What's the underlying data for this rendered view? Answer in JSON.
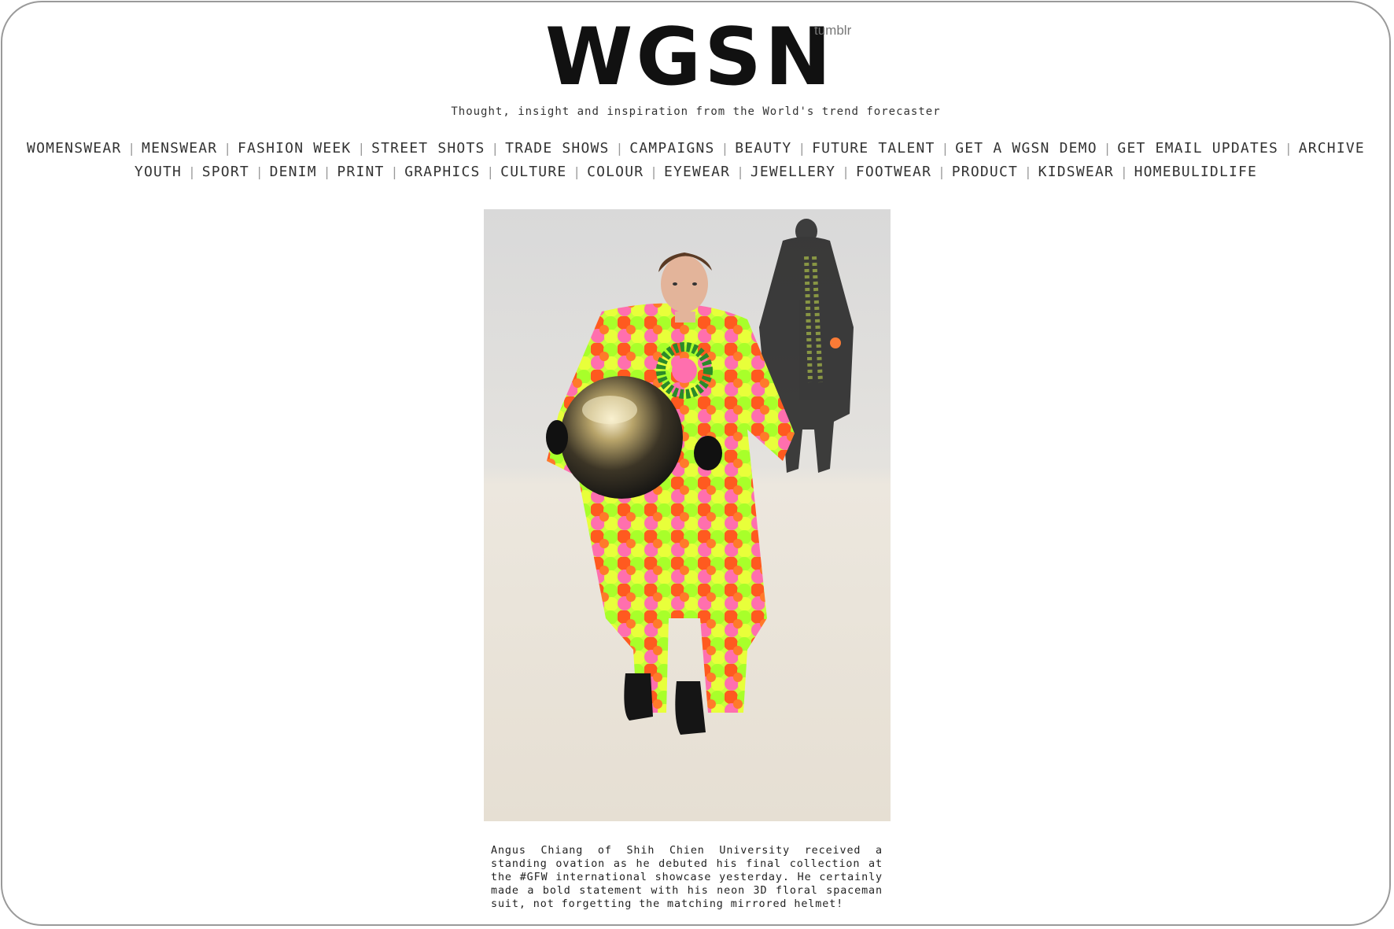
{
  "header": {
    "logo_text": "WGSN",
    "logo_sub": "tumblr",
    "tagline": "Thought, insight and inspiration from the World's trend forecaster"
  },
  "nav": {
    "row1": [
      "WOMENSWEAR",
      "MENSWEAR",
      "FASHION WEEK",
      "STREET SHOTS",
      "TRADE SHOWS",
      "CAMPAIGNS",
      "BEAUTY",
      "FUTURE TALENT",
      "GET A WGSN DEMO",
      "GET EMAIL UPDATES",
      "ARCHIVE"
    ],
    "row2": [
      "YOUTH",
      "SPORT",
      "DENIM",
      "PRINT",
      "GRAPHICS",
      "CULTURE",
      "COLOUR",
      "EYEWEAR",
      "JEWELLERY",
      "FOOTWEAR",
      "PRODUCT",
      "KIDSWEAR",
      "HOMEBULIDLIFE"
    ],
    "separator": "|"
  },
  "post": {
    "caption": "Angus Chiang of Shih Chien University received a standing ovation as he debuted his final collection at the #GFW international showcase yesterday. He certainly made a bold statement with his neon 3D floral spaceman suit, not forgetting the matching mirrored helmet!"
  },
  "colors": {
    "neon_orange": "#ff5a1f",
    "neon_green": "#a8ff2a",
    "neon_pink": "#ff6fae",
    "neon_yellow": "#e8ff3a",
    "runway": "#e9e4dc"
  }
}
